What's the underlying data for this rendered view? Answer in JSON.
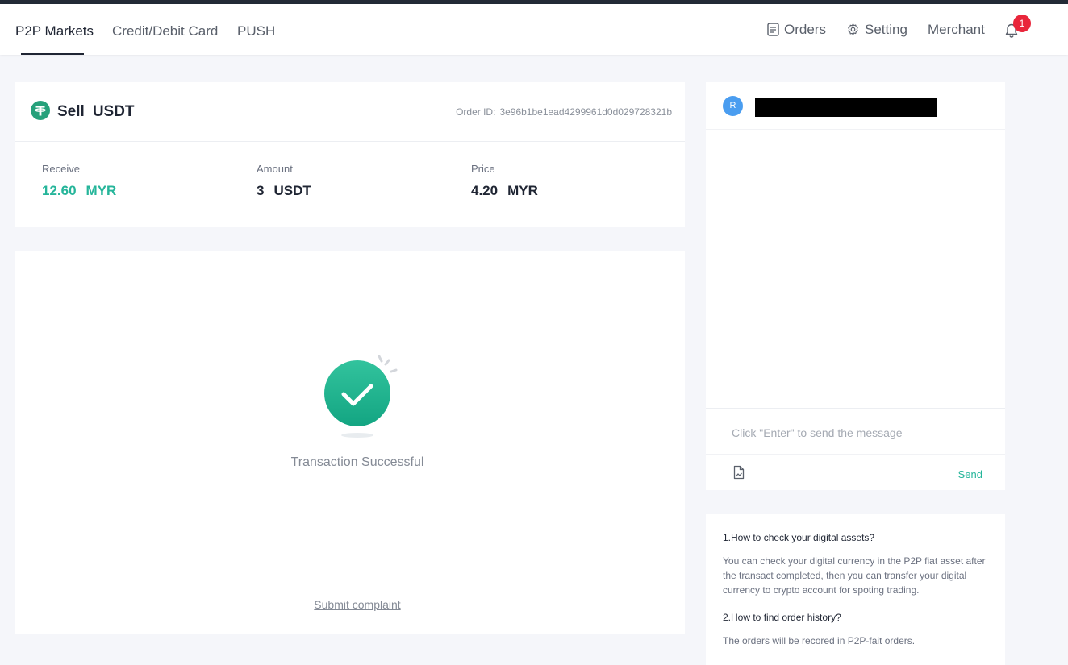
{
  "nav": {
    "tabs": [
      {
        "label": "P2P Markets",
        "active": true
      },
      {
        "label": "Credit/Debit Card",
        "active": false
      },
      {
        "label": "PUSH",
        "active": false
      }
    ],
    "orders_label": "Orders",
    "setting_label": "Setting",
    "merchant_label": "Merchant",
    "notification_count": "1"
  },
  "order": {
    "side": "Sell",
    "coin": "USDT",
    "order_id_label": "Order ID:",
    "order_id": "3e96b1be1ead4299961d0d029728321b",
    "receive": {
      "label": "Receive",
      "amount": "12.60",
      "unit": "MYR"
    },
    "amount": {
      "label": "Amount",
      "amount": "3",
      "unit": "USDT"
    },
    "price": {
      "label": "Price",
      "amount": "4.20",
      "unit": "MYR"
    }
  },
  "result": {
    "status": "Transaction Successful",
    "complaint_label": "Submit complaint"
  },
  "chat": {
    "avatar_initial": "R",
    "input_placeholder": "Click \"Enter\" to send the message",
    "send_label": "Send"
  },
  "faq": [
    {
      "q": "1.How to check your digital assets?",
      "a": "You can check your digital currency in the P2P fiat asset after the transact completed, then you can transfer your digital currency to crypto account for spoting trading."
    },
    {
      "q": "2.How to find order history?",
      "a": "The orders will be recored in P2P-fait orders."
    }
  ],
  "colors": {
    "accent": "#25b59a",
    "badge": "#e9263b",
    "text_dark": "#1f2533",
    "text_muted": "#848a95"
  },
  "icons": [
    "tether-icon",
    "orders-icon",
    "gear-icon",
    "bell-icon",
    "check-circle-icon",
    "attach-file-icon"
  ]
}
